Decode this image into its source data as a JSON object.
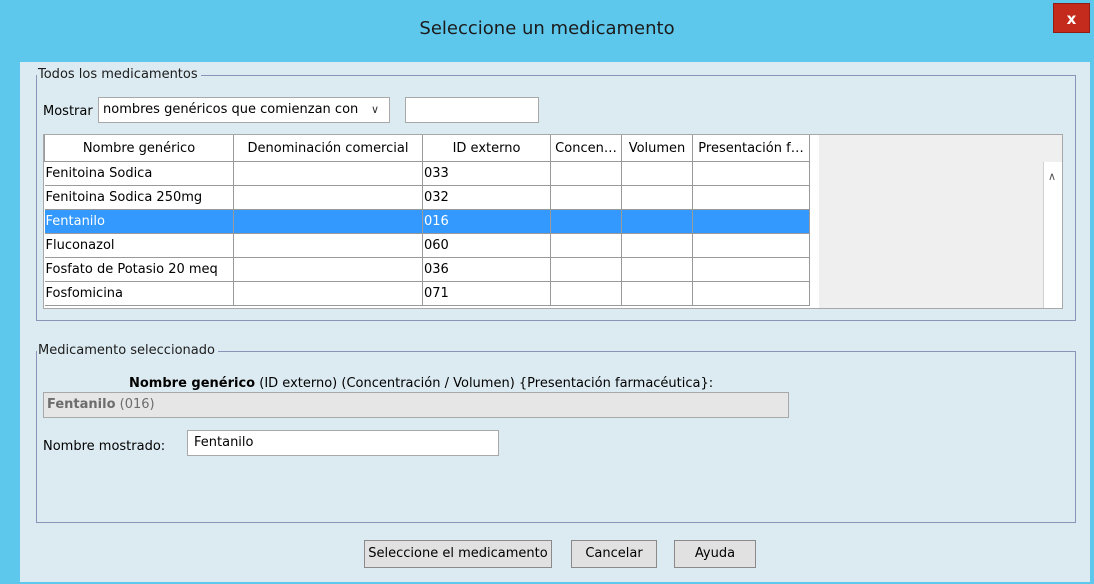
{
  "window": {
    "title": "Seleccione un medicamento",
    "close_label": "x"
  },
  "all_group": {
    "legend": "Todos los medicamentos",
    "show_label": "Mostrar",
    "show_select_value": "nombres genéricos que comienzan con",
    "filter_value": "",
    "columns": [
      "Nombre genérico",
      "Denominación comercial",
      "ID externo",
      "Concen…",
      "Volumen",
      "Presentación f…"
    ],
    "rows": [
      {
        "name": "Fenitoina Sodica",
        "brand": "",
        "ext_id": "033",
        "conc": "",
        "vol": "",
        "form": ""
      },
      {
        "name": "Fenitoina Sodica 250mg",
        "brand": "",
        "ext_id": "032",
        "conc": "",
        "vol": "",
        "form": ""
      },
      {
        "name": "Fentanilo",
        "brand": "",
        "ext_id": "016",
        "conc": "",
        "vol": "",
        "form": ""
      },
      {
        "name": "Fluconazol",
        "brand": "",
        "ext_id": "060",
        "conc": "",
        "vol": "",
        "form": ""
      },
      {
        "name": "Fosfato de Potasio 20 meq",
        "brand": "",
        "ext_id": "036",
        "conc": "",
        "vol": "",
        "form": ""
      },
      {
        "name": "Fosfomicina",
        "brand": "",
        "ext_id": "071",
        "conc": "",
        "vol": "",
        "form": ""
      }
    ],
    "selected_row_index": 2
  },
  "selected_group": {
    "legend": "Medicamento seleccionado",
    "caption_bold": "Nombre genérico",
    "caption_rest": " (ID externo) (Concentración / Volumen) {Presentación farmacéutica}:",
    "selected_name": "Fentanilo",
    "selected_id": " (016)",
    "display_name_label": "Nombre mostrado:",
    "display_name_value": "Fentanilo"
  },
  "buttons": {
    "select": "Seleccione el medicamento",
    "cancel": "Cancelar",
    "help": "Ayuda"
  },
  "colors": {
    "titlebar": "#5ec7ec",
    "client_bg": "#dcebf2",
    "selection": "#3399ff",
    "close": "#c42b1c"
  },
  "icons": {
    "dropdown": "chevron-down-icon",
    "scroll_up": "chevron-up-icon"
  }
}
